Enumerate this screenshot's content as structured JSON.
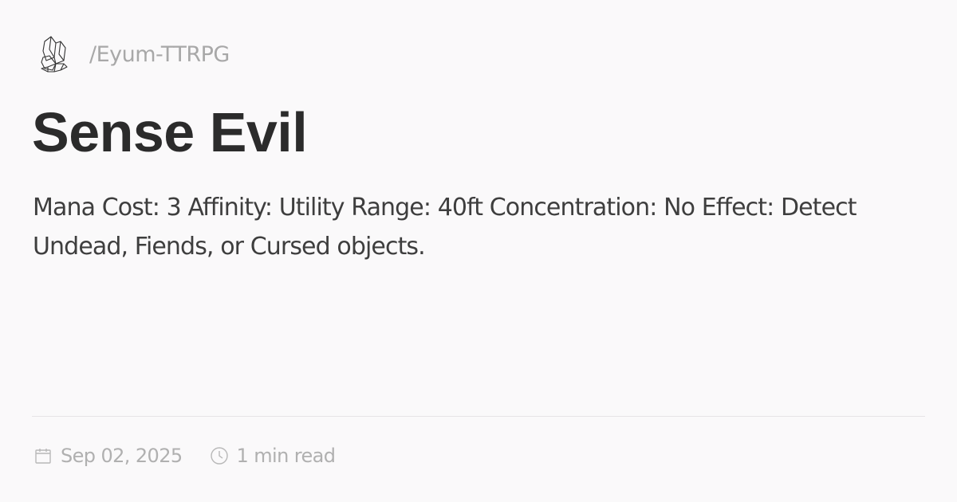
{
  "site": {
    "name": "/Eyum-TTRPG",
    "logo_icon": "crystal-icon"
  },
  "page": {
    "title": "Sense Evil",
    "description": "Mana Cost: 3 Affinity: Utility Range: 40ft Concentration: No Effect: Detect Undead, Fiends, or Cursed objects."
  },
  "meta": {
    "date": "Sep 02, 2025",
    "date_icon": "calendar-icon",
    "read_time": "1 min read",
    "read_time_icon": "clock-icon"
  }
}
